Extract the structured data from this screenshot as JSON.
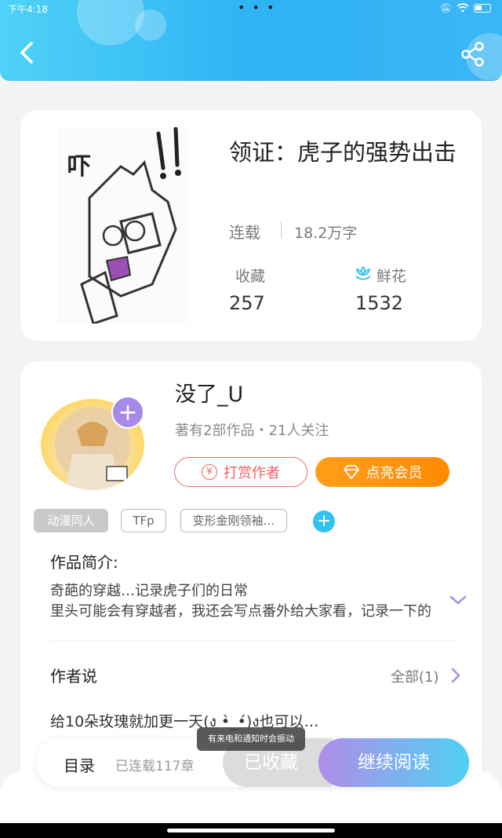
{
  "status_bar": {
    "time": "下午4:18",
    "dots": "• • •"
  },
  "book": {
    "title": "领证：虎子的强势出击",
    "status": "连载",
    "words": "18.2万字",
    "favorites_label": "收藏",
    "favorites_value": "257",
    "flowers_label": "鲜花",
    "flowers_value": "1532",
    "cover_text": "吓"
  },
  "author": {
    "name": "没了_U",
    "meta": "著有2部作品・21人关注",
    "reward_label": "打赏作者",
    "vip_label": "点亮会员",
    "follow_symbol": "+"
  },
  "tags": [
    "动漫同人",
    "TFp",
    "变形金刚领袖…"
  ],
  "tag_add_symbol": "+",
  "intro": {
    "title": "作品简介:",
    "line1": "奇葩的穿越…记录虎子们的日常",
    "line2": "里头可能会有穿越者，我还会写点番外给大家看，记录一下的"
  },
  "author_say": {
    "title": "作者说",
    "all_label": "全部(1)",
    "text": "给10朵玫瑰就加更一天(ง •̀_•́)ง也可以…"
  },
  "bottom": {
    "toc_label": "目录",
    "chapters": "已连载117章",
    "collected_label": "已收藏",
    "continue_label": "继续阅读"
  },
  "toast": "有来电和通知时会振动",
  "colors": {
    "header": "#2fb3f4",
    "accent_purple": "#a78ae8",
    "vip_orange": "#ff8a00",
    "reward_red": "#f06060"
  }
}
